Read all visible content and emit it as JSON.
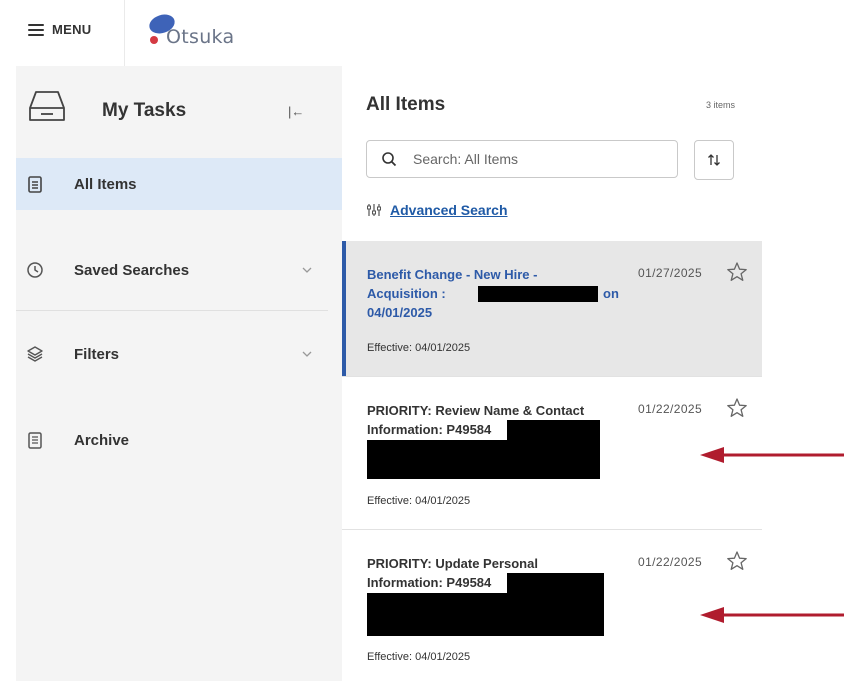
{
  "topbar": {
    "menu_label": "MENU",
    "logo_text": "Otsuka",
    "logo_color": "#3e63b8"
  },
  "sidebar": {
    "title": "My Tasks",
    "items": [
      {
        "label": "All Items",
        "icon": "clipboard-icon",
        "active": true
      },
      {
        "label": "Saved Searches",
        "icon": "clock-icon",
        "expandable": true
      },
      {
        "label": "Filters",
        "icon": "layers-icon",
        "expandable": true
      },
      {
        "label": "Archive",
        "icon": "archive-icon"
      }
    ]
  },
  "main": {
    "title": "All Items",
    "count": "3 items",
    "search_placeholder": "Search: All Items",
    "advanced_search": "Advanced Search",
    "tasks": [
      {
        "title_line1": "Benefit Change - New Hire -",
        "title_line2_prefix": "Acquisition :",
        "title_line2_suffix": "on",
        "title_line3": "04/01/2025",
        "date": "01/27/2025",
        "effective": "Effective: 04/01/2025",
        "selected": true
      },
      {
        "title_line1": "PRIORITY: Review Name & Contact",
        "title_line2": "Information: P49584",
        "date": "01/22/2025",
        "effective": "Effective: 04/01/2025"
      },
      {
        "title_line1": "PRIORITY: Update Personal",
        "title_line2": "Information: P49584",
        "date": "01/22/2025",
        "effective": "Effective: 04/01/2025"
      }
    ]
  },
  "colors": {
    "accent": "#2d5aa8",
    "active_bg": "#dde9f7",
    "annotation_arrow": "#b01c2e"
  }
}
